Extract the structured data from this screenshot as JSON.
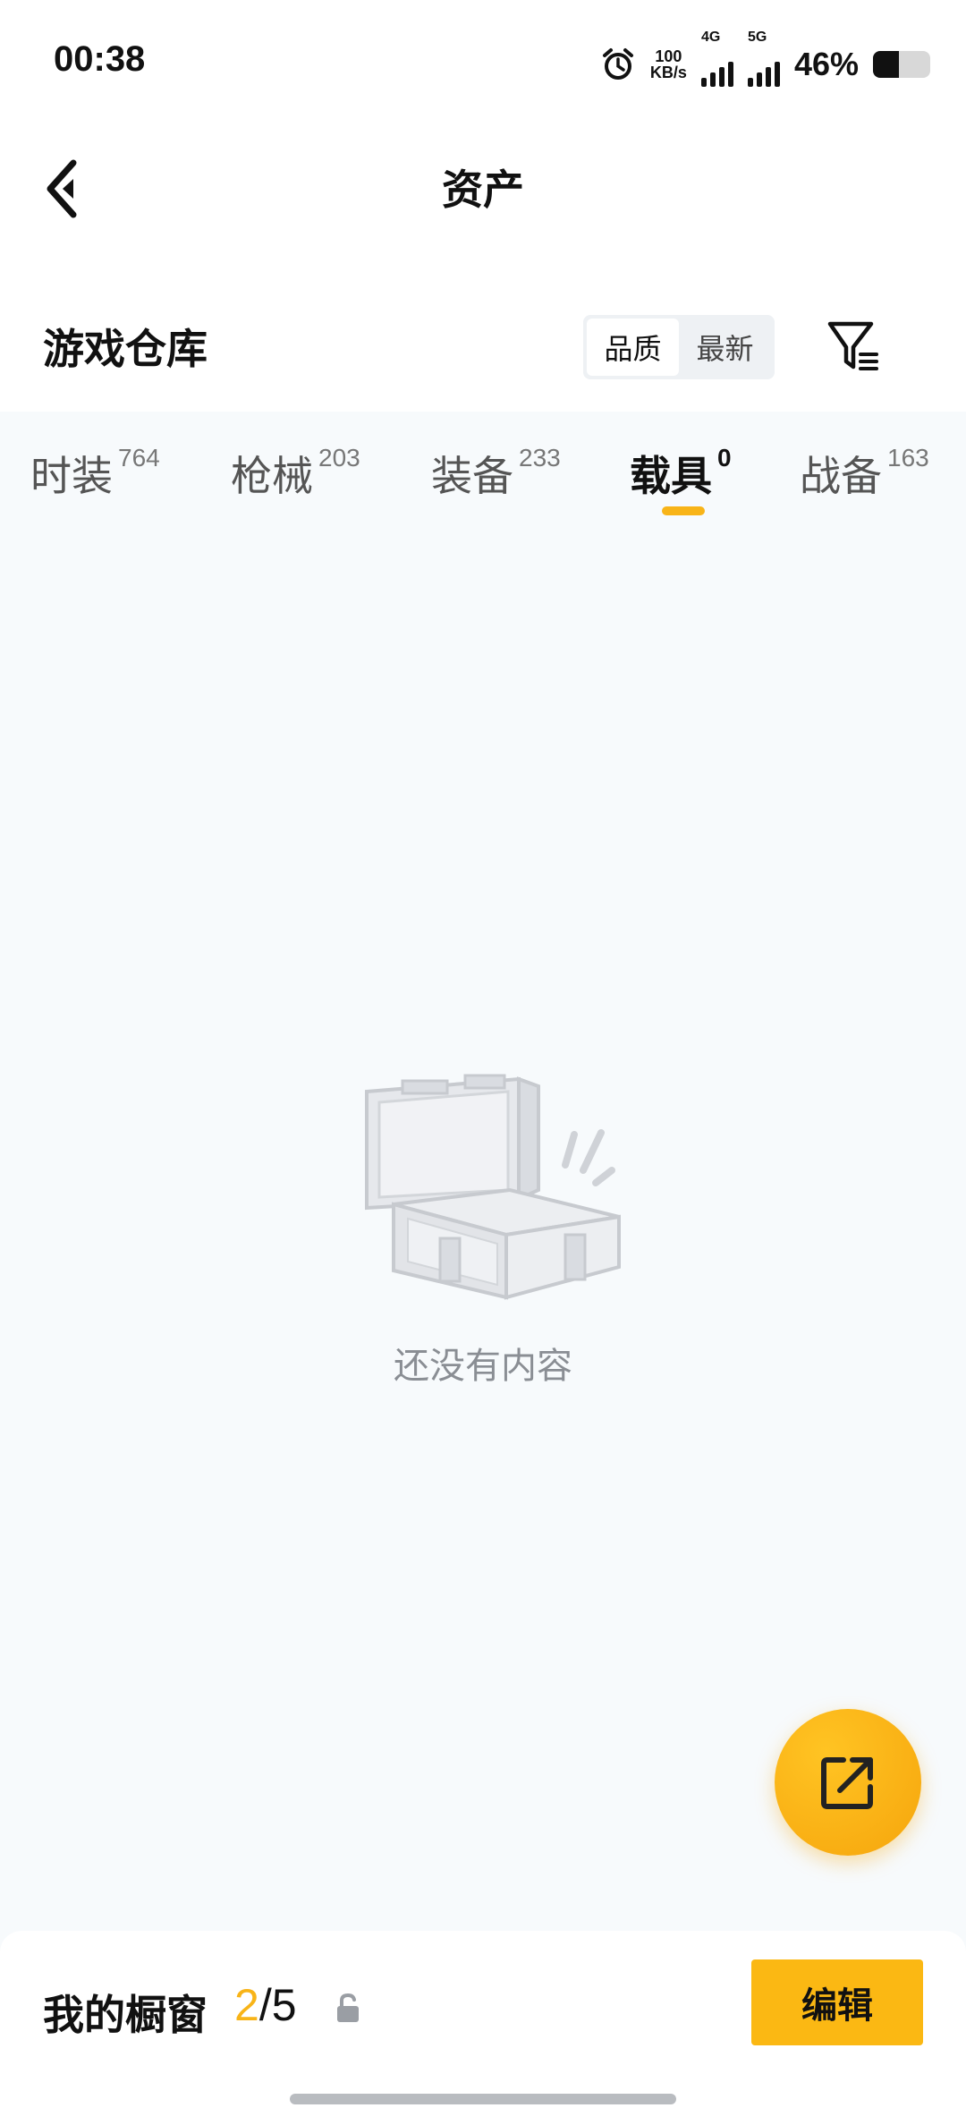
{
  "status_bar": {
    "time": "00:38",
    "net_speed_value": "100",
    "net_speed_unit": "KB/s",
    "signal_1_label": "4G",
    "signal_2_label": "5G",
    "battery_percent_text": "46%",
    "battery_level": 0.46
  },
  "header": {
    "title": "资产",
    "back_icon": "chevron-left-icon"
  },
  "section": {
    "title": "游戏仓库",
    "sort_options": [
      {
        "label": "品质",
        "active": true
      },
      {
        "label": "最新",
        "active": false
      }
    ],
    "filter_icon": "filter-icon"
  },
  "tabs": [
    {
      "label": "时装",
      "count": "764",
      "active": false
    },
    {
      "label": "枪械",
      "count": "203",
      "active": false
    },
    {
      "label": "装备",
      "count": "233",
      "active": false
    },
    {
      "label": "载具",
      "count": "0",
      "active": true
    },
    {
      "label": "战备",
      "count": "163",
      "active": false
    }
  ],
  "empty_state": {
    "icon": "open-box-icon",
    "text": "还没有内容"
  },
  "fab": {
    "icon": "share-external-icon"
  },
  "bottom_bar": {
    "showcase_label": "我的橱窗",
    "showcase_current": "2",
    "showcase_separator": "/",
    "showcase_total": "5",
    "lock_icon": "lock-icon",
    "edit_label": "编辑"
  },
  "colors": {
    "accent": "#f8b418",
    "background": "#f7fafc",
    "text_primary": "#111111",
    "text_secondary": "#8a8e94"
  }
}
